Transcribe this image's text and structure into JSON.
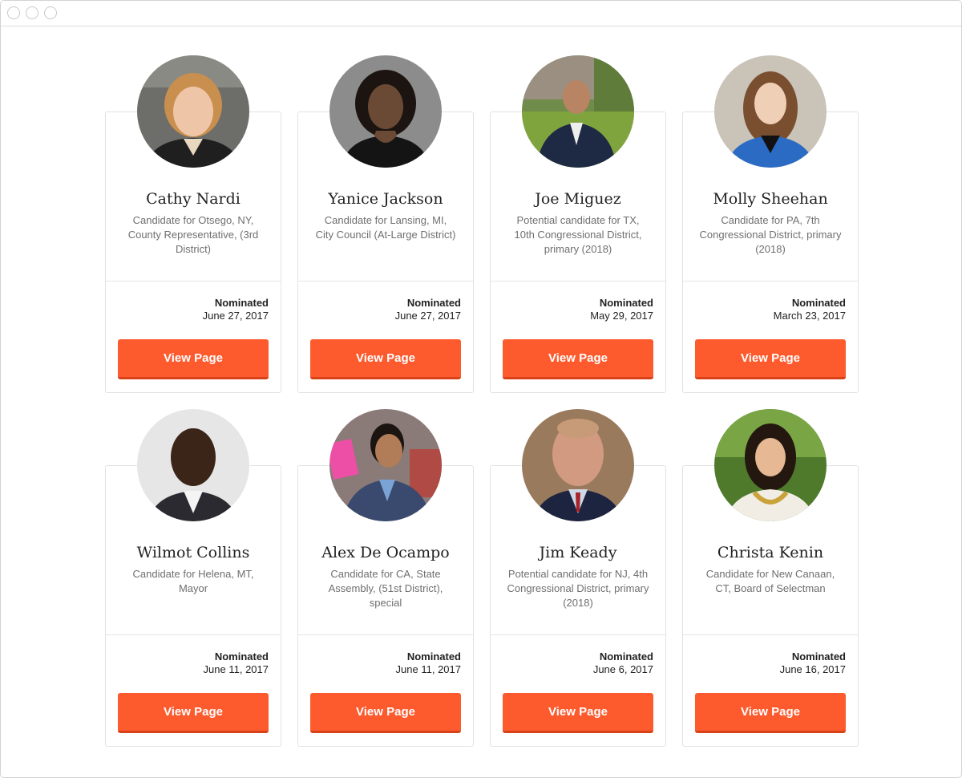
{
  "candidates": [
    {
      "name": "Cathy Nardi",
      "description": "Candidate for Otsego, NY, County Representative, (3rd District)",
      "nominated_label": "Nominated",
      "nominated_date": "June 27, 2017",
      "button_label": "View Page"
    },
    {
      "name": "Yanice Jackson",
      "description": "Candidate for Lansing, MI, City Council (At-Large District)",
      "nominated_label": "Nominated",
      "nominated_date": "June 27, 2017",
      "button_label": "View Page"
    },
    {
      "name": "Joe Miguez",
      "description": "Potential candidate for TX, 10th Congressional District, primary (2018)",
      "nominated_label": "Nominated",
      "nominated_date": "May 29, 2017",
      "button_label": "View Page"
    },
    {
      "name": "Molly Sheehan",
      "description": "Candidate for PA, 7th Congressional District, primary (2018)",
      "nominated_label": "Nominated",
      "nominated_date": "March 23, 2017",
      "button_label": "View Page"
    },
    {
      "name": "Wilmot Collins",
      "description": "Candidate for Helena, MT, Mayor",
      "nominated_label": "Nominated",
      "nominated_date": "June 11, 2017",
      "button_label": "View Page"
    },
    {
      "name": "Alex De Ocampo",
      "description": "Candidate for CA, State Assembly, (51st District), special",
      "nominated_label": "Nominated",
      "nominated_date": "June 11, 2017",
      "button_label": "View Page"
    },
    {
      "name": "Jim Keady",
      "description": "Potential candidate for NJ, 4th Congressional District, primary (2018)",
      "nominated_label": "Nominated",
      "nominated_date": "June 6, 2017",
      "button_label": "View Page"
    },
    {
      "name": "Christa Kenin",
      "description": "Candidate for New Canaan, CT, Board of Selectman",
      "nominated_label": "Nominated",
      "nominated_date": "June 16, 2017",
      "button_label": "View Page"
    }
  ],
  "colors": {
    "button": "#fd5a2e",
    "button_shadow": "#d84218",
    "card_border": "#e2e2e2"
  }
}
